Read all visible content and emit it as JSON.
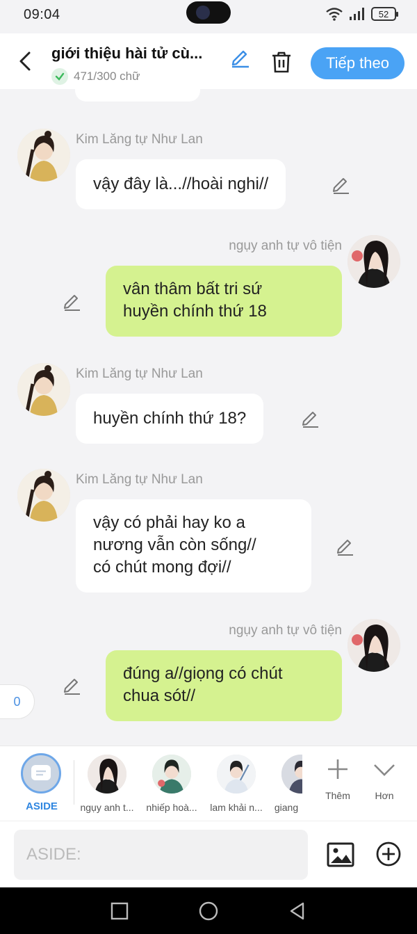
{
  "status_bar": {
    "time": "09:04",
    "battery": "52"
  },
  "header": {
    "title": "giới thiệu hài tử cù...",
    "word_count": "471/300 chữ",
    "next_label": "Tiếp theo"
  },
  "messages": [
    {
      "sender": "Kim Lăng tự Như Lan",
      "side": "left",
      "lines": [
        "vậy đây là...//hoài nghi//"
      ]
    },
    {
      "sender": "ngụy anh tự vô tiện",
      "side": "right",
      "lines": [
        "vân thâm bất tri sứ",
        "huyền chính thứ 18"
      ]
    },
    {
      "sender": "Kim Lăng tự Như Lan",
      "side": "left",
      "lines": [
        "huyền chính thứ 18?"
      ]
    },
    {
      "sender": "Kim Lăng tự Như Lan",
      "side": "left",
      "lines": [
        "vậy có phải hay ko a",
        "nương vẫn còn sống//",
        "có chút mong đợi//"
      ]
    },
    {
      "sender": "ngụy anh tự vô tiện",
      "side": "right",
      "lines": [
        "đúng a//giọng có chút",
        "chua sót//"
      ]
    }
  ],
  "unread_badge": "0",
  "character_bar": {
    "aside_label": "ASIDE",
    "characters": [
      {
        "name": "ngụy anh t..."
      },
      {
        "name": "nhiếp hoà..."
      },
      {
        "name": "lam khải n..."
      },
      {
        "name": "giang"
      }
    ],
    "add_label": "Thêm",
    "more_label": "Hơn"
  },
  "input": {
    "placeholder": "ASIDE:"
  },
  "colors": {
    "accent": "#4aa3f5",
    "right_bubble": "#d5f290",
    "left_bubble": "#ffffff",
    "background": "#f3f3f5"
  }
}
